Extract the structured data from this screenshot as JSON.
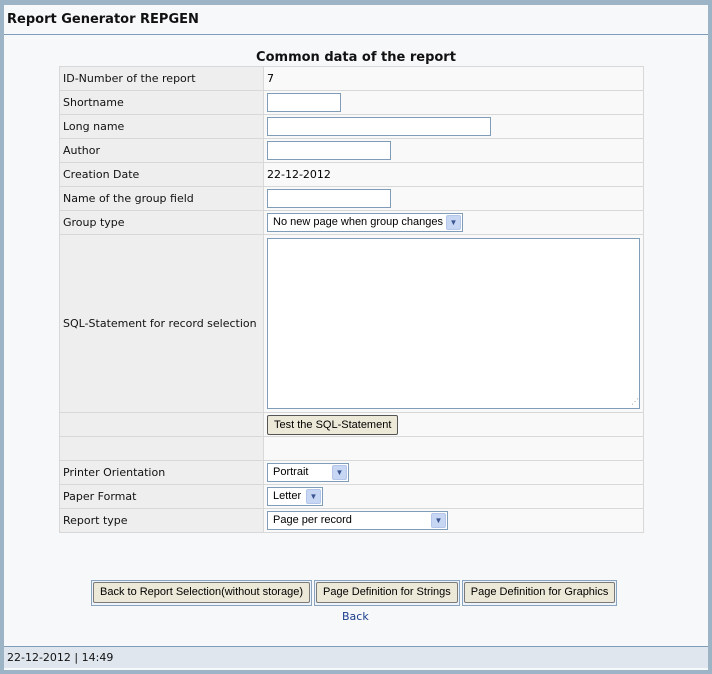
{
  "page": {
    "title": "Report Generator REPGEN",
    "section_heading": "Common data of the report"
  },
  "form": {
    "id_label": "ID-Number of the report",
    "id_value": "7",
    "shortname_label": "Shortname",
    "shortname_value": "",
    "longname_label": "Long name",
    "longname_value": "",
    "author_label": "Author",
    "author_value": "",
    "creation_label": "Creation Date",
    "creation_value": "22-12-2012",
    "groupfield_label": "Name of the group field",
    "groupfield_value": "",
    "grouptype_label": "Group type",
    "grouptype_value": "No new page when group changes",
    "sql_label": "SQL-Statement for record selection",
    "sql_value": "",
    "test_sql_button": "Test the SQL-Statement",
    "orientation_label": "Printer Orientation",
    "orientation_value": "Portrait",
    "paper_label": "Paper Format",
    "paper_value": "Letter",
    "reporttype_label": "Report type",
    "reporttype_value": "Page per record"
  },
  "actions": {
    "back_to_selection": "Back to Report Selection(without storage)",
    "page_def_strings": "Page Definition for Strings",
    "page_def_graphics": "Page Definition for Graphics",
    "back_link": "Back"
  },
  "status": {
    "text": "22-12-2012 | 14:49"
  },
  "icons": {
    "dropdown": "chevron-down-icon",
    "grip": "resize-grip-icon"
  },
  "colors": {
    "border_accent": "#9db3c6",
    "link": "#1a3d8c",
    "field_border": "#7f9db9"
  }
}
